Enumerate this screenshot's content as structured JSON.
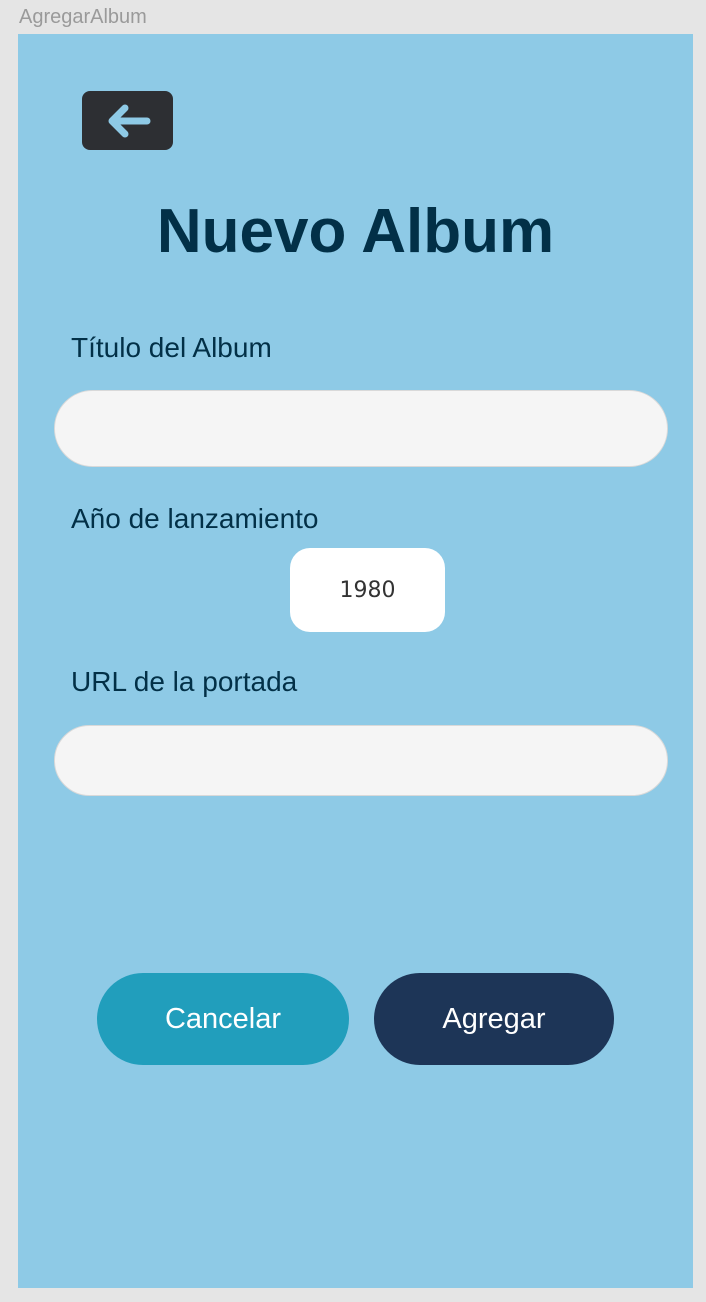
{
  "frame": {
    "label": "AgregarAlbum"
  },
  "header": {
    "back_icon": "arrow-left-icon",
    "title": "Nuevo Album"
  },
  "form": {
    "title_field": {
      "label": "Título del Album",
      "value": "",
      "placeholder": ""
    },
    "year_field": {
      "label": "Año de lanzamiento",
      "value": "1980"
    },
    "cover_field": {
      "label": "URL de la portada",
      "value": "",
      "placeholder": ""
    }
  },
  "actions": {
    "cancel_label": "Cancelar",
    "add_label": "Agregar"
  },
  "colors": {
    "background": "#8ecae6",
    "title": "#023047",
    "cancel_button": "#219ebc",
    "add_button": "#1d3557",
    "back_button": "#2d2f33",
    "back_arrow": "#8ecae6"
  }
}
